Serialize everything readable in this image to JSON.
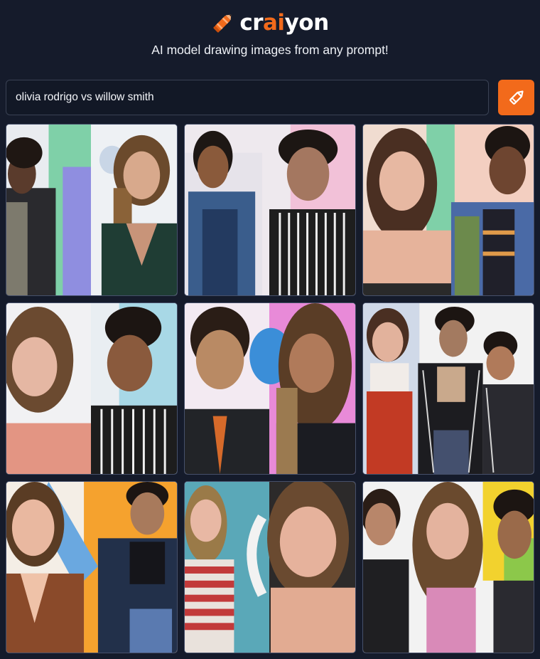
{
  "brand": {
    "name_prefix": "cr",
    "name_highlight": "ai",
    "name_suffix": "yon",
    "accent_color": "#f26a1b",
    "icon": "crayon-icon"
  },
  "tagline": "AI model drawing images from any prompt!",
  "search": {
    "value": "olivia rodrigo vs willow smith",
    "button_icon": "pencil-icon"
  },
  "results": {
    "count": 9,
    "columns": 3
  }
}
